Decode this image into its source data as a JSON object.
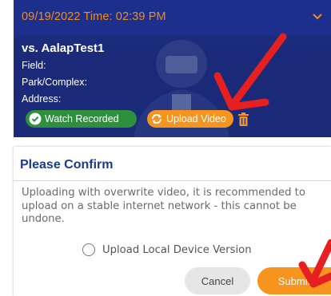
{
  "game_card": {
    "header": "09/19/2022 Time: 02:39 PM",
    "opponent": "vs. AalapTest1",
    "field_label": "Field:",
    "park_label": "Park/Complex:",
    "address_label": "Address:",
    "watch_button": "Watch Recorded",
    "upload_button": "Upload Video",
    "icons": [
      "chevron-down-icon",
      "check-circle-icon",
      "refresh-icon",
      "trash-icon"
    ],
    "colors": {
      "header_bg": "#1c2f8c",
      "header_text": "#f28c1c",
      "watch": "#2e8f3c",
      "upload": "#f7941d",
      "arrow": "#e62020"
    }
  },
  "confirm_dialog": {
    "title": "Please Confirm",
    "message": "Uploading with overwrite video, it is recommended to upload on a stable internet network - this cannot be undone.",
    "option_label": "Upload Local Device Version",
    "cancel_label": "Cancel",
    "submit_label": "Submit",
    "colors": {
      "title": "#1c3a8c",
      "submit": "#f7941d",
      "cancel": "#e6e6e6"
    }
  }
}
